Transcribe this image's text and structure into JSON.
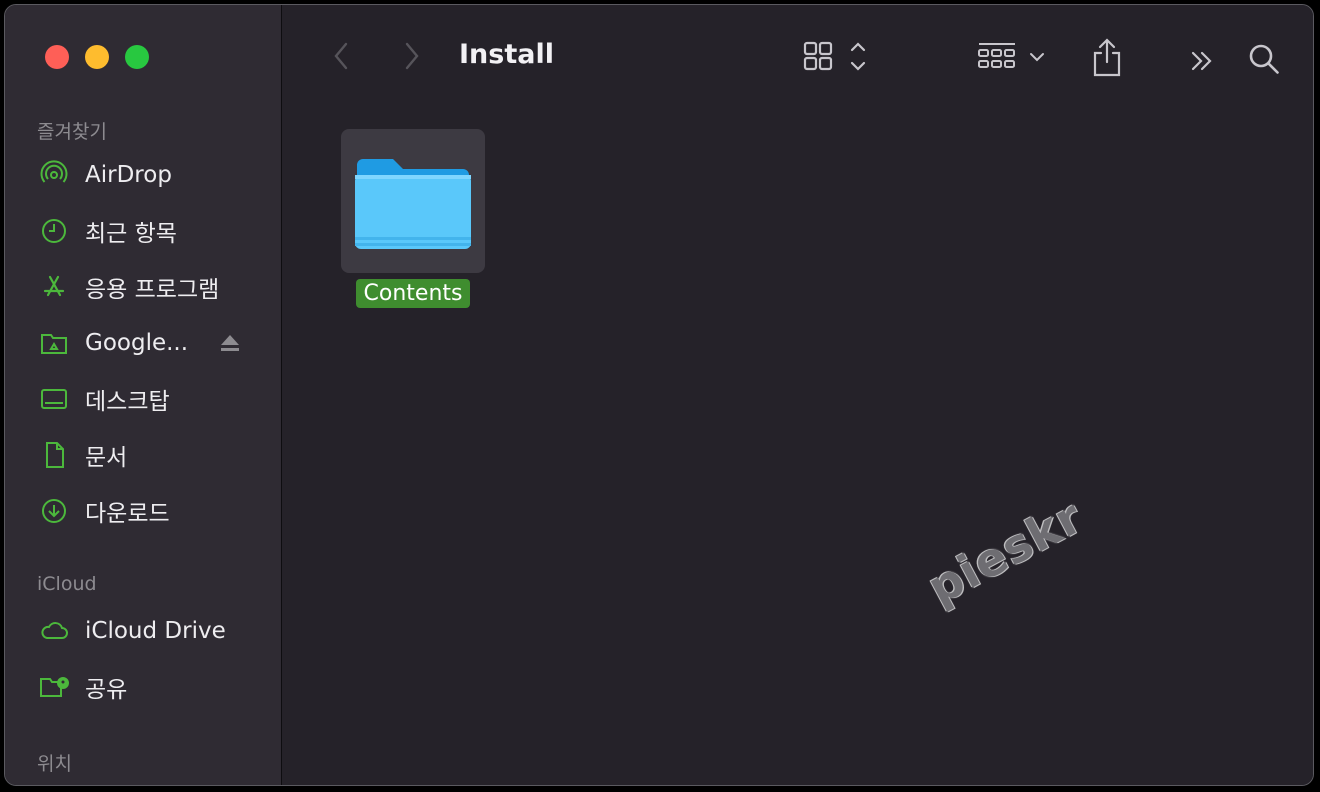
{
  "window": {
    "title": "Install"
  },
  "sidebar": {
    "favorites_title": "즐겨찾기",
    "icloud_title": "iCloud",
    "locations_title": "위치",
    "favorites": [
      {
        "label": "AirDrop",
        "icon": "airdrop-icon"
      },
      {
        "label": "최근 항목",
        "icon": "clock-icon"
      },
      {
        "label": "응용 프로그램",
        "icon": "applications-icon"
      },
      {
        "label": "Google...",
        "icon": "google-drive-folder-icon"
      },
      {
        "label": "데스크탑",
        "icon": "desktop-icon"
      },
      {
        "label": "문서",
        "icon": "document-icon"
      },
      {
        "label": "다운로드",
        "icon": "download-icon"
      }
    ],
    "icloud": [
      {
        "label": "iCloud Drive",
        "icon": "cloud-icon"
      },
      {
        "label": "공유",
        "icon": "shared-folder-icon"
      }
    ]
  },
  "content": {
    "items": [
      {
        "name": "Contents",
        "type": "folder"
      }
    ]
  },
  "watermark": "pieskr",
  "colors": {
    "accent": "#4cb83c",
    "selection_label": "#3f8d2f",
    "folder_blue": "#5ac8fa"
  }
}
